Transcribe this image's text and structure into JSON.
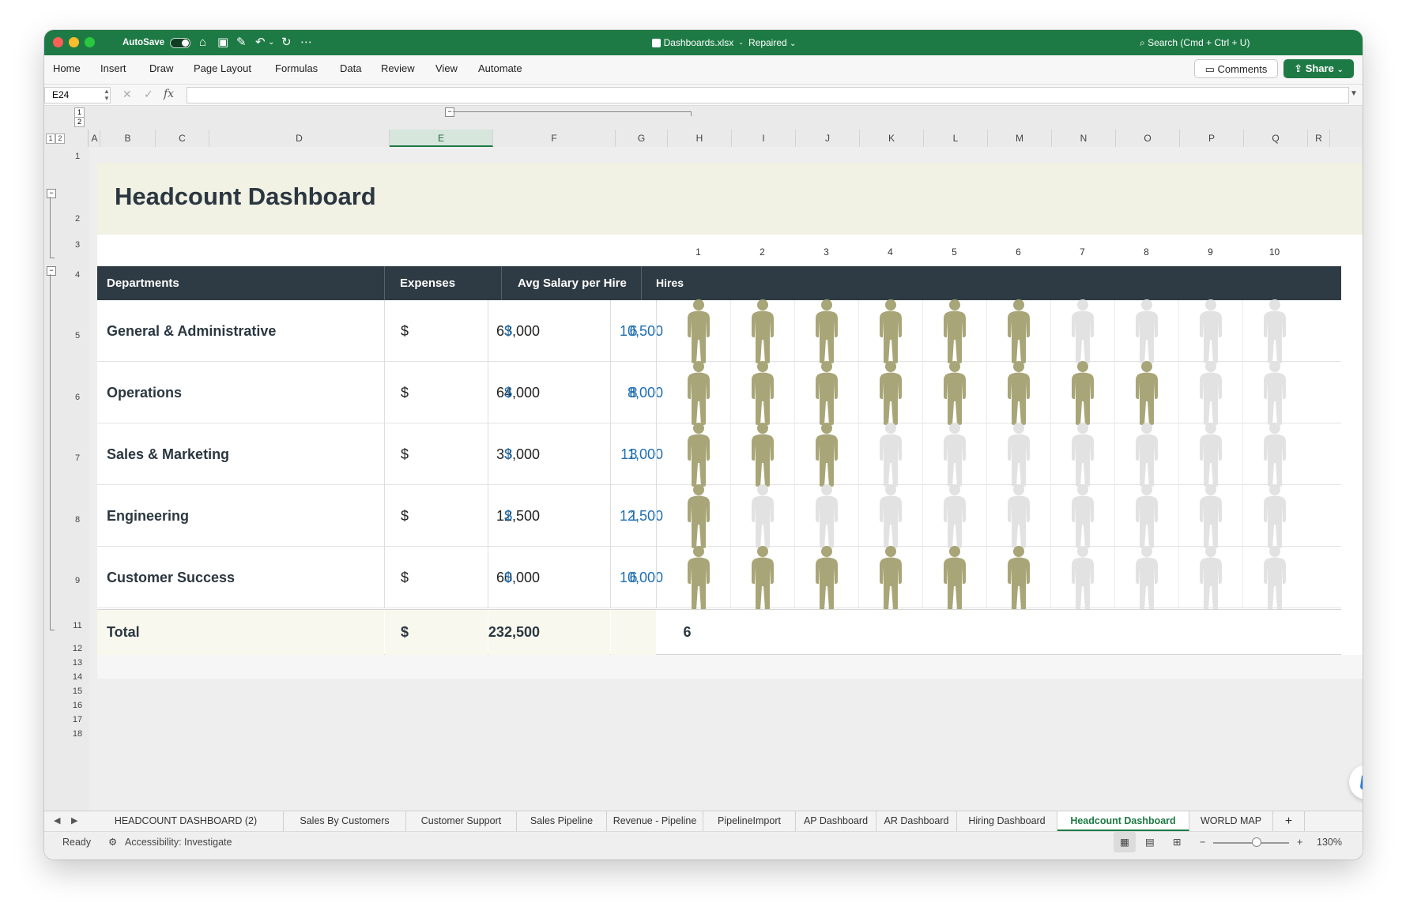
{
  "titlebar": {
    "autosave_label": "AutoSave",
    "file_name": "Dashboards.xlsx",
    "separator": "-",
    "file_status": "Repaired",
    "search_placeholder": "Search (Cmd + Ctrl + U)"
  },
  "ribbon": {
    "tabs": [
      "Home",
      "Insert",
      "Draw",
      "Page Layout",
      "Formulas",
      "Data",
      "Review",
      "View",
      "Automate"
    ],
    "comments_label": "Comments",
    "share_label": "Share"
  },
  "formula_bar": {
    "cell_ref": "E24",
    "fx_label": "fx",
    "value": ""
  },
  "outline_levels": [
    "1",
    "2"
  ],
  "columns": [
    "A",
    "B",
    "C",
    "D",
    "E",
    "F",
    "G",
    "H",
    "I",
    "J",
    "K",
    "L",
    "M",
    "N",
    "O",
    "P",
    "Q",
    "R"
  ],
  "selected_column": "E",
  "rows": [
    "1",
    "2",
    "3",
    "4",
    "5",
    "6",
    "7",
    "8",
    "9",
    "11",
    "12",
    "13",
    "14",
    "15",
    "16",
    "17",
    "18"
  ],
  "dashboard": {
    "title": "Headcount Dashboard",
    "headers": {
      "departments": "Departments",
      "expenses": "Expenses",
      "avg_salary": "Avg Salary per Hire",
      "hires": "Hires"
    },
    "currency_symbol": "$",
    "icon_numbers": [
      "1",
      "2",
      "3",
      "4",
      "5",
      "6",
      "7",
      "8",
      "9",
      "10"
    ],
    "departments": [
      {
        "name": "General & Administrative",
        "expenses": "63,000",
        "avg_salary": "10,500",
        "hires": "6",
        "filled_icons": 6
      },
      {
        "name": "Operations",
        "expenses": "64,000",
        "avg_salary": "8,000",
        "hires": "8",
        "filled_icons": 8
      },
      {
        "name": "Sales & Marketing",
        "expenses": "33,000",
        "avg_salary": "11,000",
        "hires": "3",
        "filled_icons": 3
      },
      {
        "name": "Engineering",
        "expenses": "12,500",
        "avg_salary": "12,500",
        "hires": "1",
        "filled_icons": 1
      },
      {
        "name": "Customer Success",
        "expenses": "60,000",
        "avg_salary": "10,000",
        "hires": "6",
        "filled_icons": 6
      }
    ],
    "total": {
      "label": "Total",
      "expenses": "232,500",
      "hires": "6"
    },
    "colors": {
      "header_bg": "#2f3b44",
      "icon_filled": "#a8a678",
      "icon_empty": "#e2e2e2",
      "value_blue": "#1f6fb2",
      "title_band": "#f1f1e4"
    }
  },
  "sheet_tabs": {
    "tabs": [
      "HEADCOUNT DASHBOARD (2)",
      "Sales By Customers",
      "Customer Support",
      "Sales Pipeline",
      "Revenue - Pipeline",
      "PipelineImport",
      "AP Dashboard",
      "AR Dashboard",
      "Hiring Dashboard",
      "Headcount Dashboard",
      "WORLD MAP"
    ],
    "active": "Headcount Dashboard",
    "add_label": "+"
  },
  "status": {
    "ready": "Ready",
    "accessibility": "Accessibility: Investigate",
    "zoom_minus": "−",
    "zoom_plus": "+",
    "zoom": "130%"
  }
}
